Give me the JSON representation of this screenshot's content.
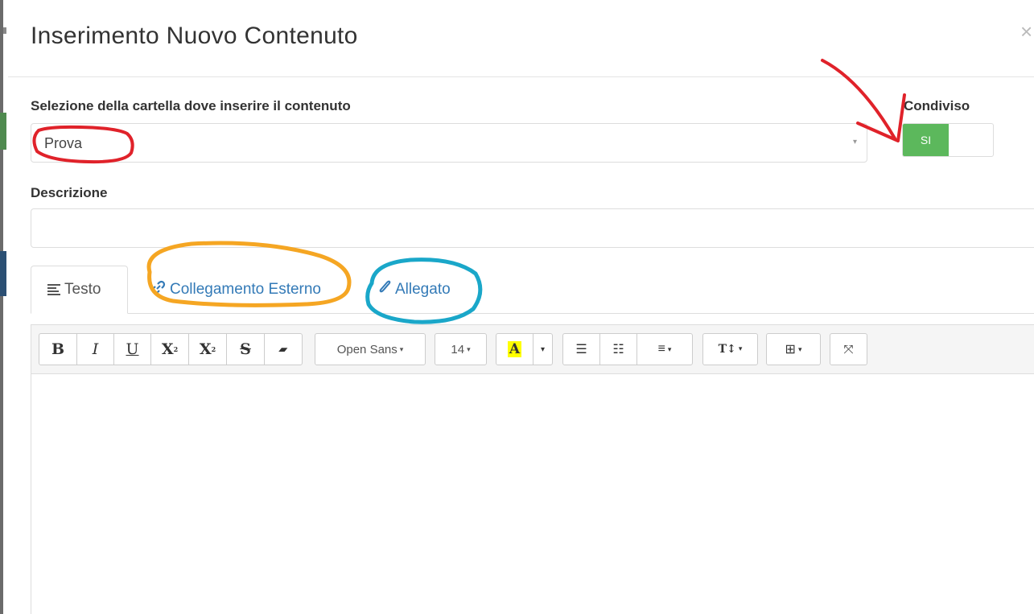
{
  "modal": {
    "title": "Inserimento Nuovo Contenuto",
    "close_glyph": "×"
  },
  "folder": {
    "label": "Selezione della cartella dove inserire il contenuto",
    "selected": "Prova"
  },
  "shared": {
    "label": "Condiviso",
    "on_label": "SI",
    "state": "on"
  },
  "description": {
    "label": "Descrizione",
    "value": ""
  },
  "tabs": [
    {
      "label": "Testo",
      "icon": "align-left-icon",
      "active": true
    },
    {
      "label": "Collegamento Esterno",
      "icon": "link-icon",
      "active": false
    },
    {
      "label": "Allegato",
      "icon": "paperclip-icon",
      "active": false
    }
  ],
  "toolbar": {
    "bold": "B",
    "italic": "I",
    "underline": "U",
    "superscript": "X",
    "superscript_mark": "2",
    "subscript": "X",
    "subscript_mark": "2",
    "strikethrough": "S",
    "eraser_glyph": "▰",
    "font_name": "Open Sans",
    "font_size": "14",
    "color_letter": "A",
    "caret": "▾",
    "unordered_list_glyph": "☰",
    "ordered_list_glyph": "☷",
    "align_glyph": "≡",
    "line_height_glyph": "T↕",
    "table_glyph": "⊞",
    "fullscreen_glyph": "⤧"
  },
  "colors": {
    "toggle_on": "#5cb85c",
    "link": "#337ab7",
    "annotation_red": "#e0222a",
    "annotation_orange": "#f5a623",
    "annotation_cyan": "#1aa7c9",
    "highlight": "#ffff00"
  }
}
